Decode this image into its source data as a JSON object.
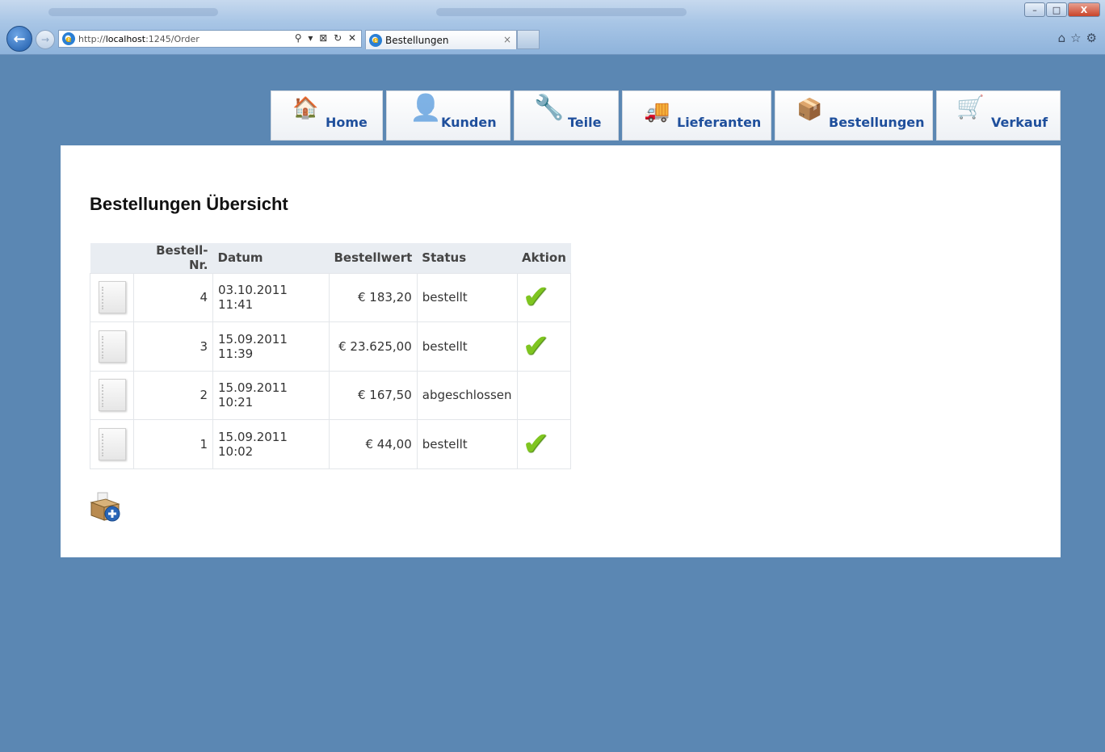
{
  "browser": {
    "url_prefix": "http://",
    "url_host": "localhost",
    "url_rest": ":1245/Order",
    "tab_title": "Bestellungen",
    "addr_tools": "⚲ ▾ ⊠ ↻ ✕",
    "tab_close": "×",
    "right_tools": "⌂☆⚙",
    "win_min": "–",
    "win_max": "□",
    "win_close": "X",
    "back_glyph": "←",
    "forward_glyph": "→",
    "ie_glyph": "e"
  },
  "nav": {
    "items": [
      {
        "label": "Home",
        "icon": "home-icon",
        "glyph": "🏠"
      },
      {
        "label": "Kunden",
        "icon": "user-icon",
        "glyph": "👤"
      },
      {
        "label": "Teile",
        "icon": "tools-icon",
        "glyph": "🔧"
      },
      {
        "label": "Lieferanten",
        "icon": "truck-icon",
        "glyph": "🚚"
      },
      {
        "label": "Bestellungen",
        "icon": "box-icon",
        "glyph": "📦"
      },
      {
        "label": "Verkauf",
        "icon": "cart-icon",
        "glyph": "🛒"
      }
    ]
  },
  "page": {
    "title": "Bestellungen Übersicht"
  },
  "table": {
    "headers": [
      "",
      "Bestell-Nr.",
      "Datum",
      "Bestellwert",
      "Status",
      "Aktion"
    ],
    "rows": [
      {
        "nr": "4",
        "datum": "03.10.2011 11:41",
        "wert": "€ 183,20",
        "status": "bestellt",
        "check": "✔"
      },
      {
        "nr": "3",
        "datum": "15.09.2011 11:39",
        "wert": "€ 23.625,00",
        "status": "bestellt",
        "check": "✔"
      },
      {
        "nr": "2",
        "datum": "15.09.2011 10:21",
        "wert": "€ 167,50",
        "status": "abgeschlossen",
        "check": ""
      },
      {
        "nr": "1",
        "datum": "15.09.2011 10:02",
        "wert": "€ 44,00",
        "status": "bestellt",
        "check": "✔"
      }
    ]
  },
  "colors": {
    "background": "#5b87b3",
    "nav_text": "#1f4f9c",
    "check": "#7fc520"
  }
}
